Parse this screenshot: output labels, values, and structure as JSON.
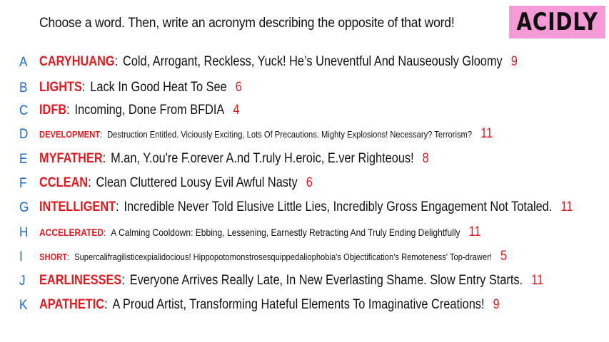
{
  "header": {
    "prompt": "Choose a word. Then, write an acronym describing the opposite of that word!",
    "badge": "ACIDLY"
  },
  "colors": {
    "letter": "#1769d6",
    "word": "#e2191f",
    "count": "#e2191f",
    "badge_bg": "#f59ad6"
  },
  "entries": [
    {
      "letter": "A",
      "word": "CARYHUANG",
      "acronym": "Cold, Arrogant, Reckless, Yuck! He’s Uneventful And Nauseously Gloomy",
      "count": "9"
    },
    {
      "letter": "B",
      "word": "LIGHTS",
      "acronym": "Lack In Good Heat To See",
      "count": "6"
    },
    {
      "letter": "C",
      "word": "IDFB",
      "acronym": "Incoming, Done From BFDIA",
      "count": "4"
    },
    {
      "letter": "D",
      "word": "DEVELOPMENT",
      "acronym": "Destruction Entitled. Viciously Exciting, Lots Of Precautions. Mighty Explosions! Necessary? Terrorism?",
      "count": "11"
    },
    {
      "letter": "E",
      "word": "MYFATHER",
      "acronym": "M.an, Y.ou're F.orever A.nd T.ruly H.eroic, E.ver Righteous!",
      "count": "8"
    },
    {
      "letter": "F",
      "word": "CCLEAN",
      "acronym": "Clean Cluttered Lousy Evil Awful Nasty",
      "count": "6"
    },
    {
      "letter": "G",
      "word": "INTELLIGENT",
      "acronym": "Incredible Never Told Elusive Little Lies, Incredibly Gross Engagement Not Totaled.",
      "count": "11"
    },
    {
      "letter": "H",
      "word": "ACCELERATED",
      "acronym": "A Calming Cooldown: Ebbing, Lessening, Earnestly Retracting And Truly Ending Delightfully",
      "count": "11"
    },
    {
      "letter": "I",
      "word": "SHORT",
      "acronym": "Supercalifragilisticexpialidocious! Hippopotomonstrosesquippedaliophobia's Objectification's Remoteness' Top-drawer!",
      "count": "5"
    },
    {
      "letter": "J",
      "word": "EARLINESSES",
      "acronym": "Everyone Arrives Really Late, In New Everlasting Shame. Slow Entry Starts.",
      "count": "11"
    },
    {
      "letter": "K",
      "word": "APATHETIC",
      "acronym": "A Proud Artist, Transforming Hateful Elements To Imaginative Creations!",
      "count": "9"
    }
  ]
}
